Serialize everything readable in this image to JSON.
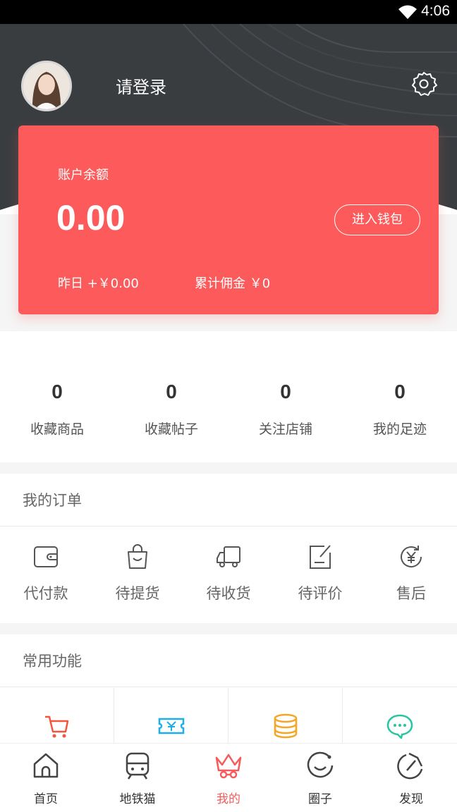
{
  "status_bar": {
    "time": "4:06",
    "wifi_icon": "wifi-icon"
  },
  "header": {
    "login_text": "请登录",
    "avatar_icon": "user-avatar",
    "settings_icon": "gear-icon"
  },
  "balance_card": {
    "label": "账户余额",
    "amount": "0.00",
    "wallet_button": "进入钱包",
    "yesterday": "昨日 +￥0.00",
    "commission": "累计佣金 ￥0",
    "color": "#fd5b5b"
  },
  "stats": [
    {
      "value": "0",
      "label": "收藏商品"
    },
    {
      "value": "0",
      "label": "收藏帖子"
    },
    {
      "value": "0",
      "label": "关注店铺"
    },
    {
      "value": "0",
      "label": "我的足迹"
    }
  ],
  "orders": {
    "title": "我的订单",
    "items": [
      {
        "label": "代付款",
        "icon": "wallet-icon"
      },
      {
        "label": "待提货",
        "icon": "shopping-bag-icon"
      },
      {
        "label": "待收货",
        "icon": "truck-icon"
      },
      {
        "label": "待评价",
        "icon": "edit-note-icon"
      },
      {
        "label": "售后",
        "icon": "yen-refresh-icon"
      }
    ]
  },
  "functions": {
    "title": "常用功能",
    "items": [
      {
        "icon": "cart-icon",
        "color": "#f4563d"
      },
      {
        "icon": "coupon-icon",
        "color": "#1eaee8"
      },
      {
        "icon": "coins-icon",
        "color": "#f6a623"
      },
      {
        "icon": "chat-bubble-icon",
        "color": "#26c6a0"
      }
    ]
  },
  "tabbar": {
    "items": [
      {
        "label": "首页",
        "icon": "home-icon",
        "active": false
      },
      {
        "label": "地铁猫",
        "icon": "subway-icon",
        "active": false
      },
      {
        "label": "我的",
        "icon": "crown-icon",
        "active": true
      },
      {
        "label": "圈子",
        "icon": "smile-circle-icon",
        "active": false
      },
      {
        "label": "发现",
        "icon": "compass-icon",
        "active": false
      }
    ],
    "active_color": "#f45b5b"
  }
}
